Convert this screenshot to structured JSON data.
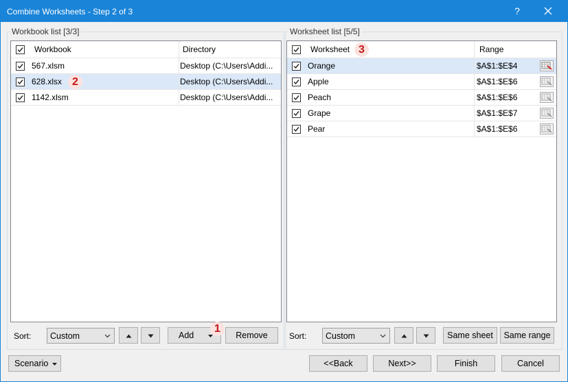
{
  "window": {
    "title": "Combine Worksheets - Step 2 of 3",
    "help_label": "?"
  },
  "workbook_panel": {
    "legend": "Workbook list [3/3]",
    "col_workbook": "Workbook",
    "col_directory": "Directory",
    "rows": [
      {
        "name": "567.xlsm",
        "directory": "Desktop (C:\\Users\\Addi...",
        "checked": true,
        "selected": false
      },
      {
        "name": "628.xlsx",
        "directory": "Desktop (C:\\Users\\Addi...",
        "checked": true,
        "selected": true
      },
      {
        "name": "1142.xlsm",
        "directory": "Desktop (C:\\Users\\Addi...",
        "checked": true,
        "selected": false
      }
    ],
    "sort_label": "Sort:",
    "sort_value": "Custom",
    "add_label": "Add",
    "remove_label": "Remove"
  },
  "worksheet_panel": {
    "legend": "Worksheet list [5/5]",
    "col_worksheet": "Worksheet",
    "col_range": "Range",
    "rows": [
      {
        "name": "Orange",
        "range": "$A$1:$E$4",
        "checked": true,
        "selected": true
      },
      {
        "name": "Apple",
        "range": "$A$1:$E$6",
        "checked": true,
        "selected": false
      },
      {
        "name": "Peach",
        "range": "$A$1:$E$6",
        "checked": true,
        "selected": false
      },
      {
        "name": "Grape",
        "range": "$A$1:$E$7",
        "checked": true,
        "selected": false
      },
      {
        "name": "Pear",
        "range": "$A$1:$E$6",
        "checked": true,
        "selected": false
      }
    ],
    "sort_label": "Sort:",
    "sort_value": "Custom",
    "same_sheet_label": "Same sheet",
    "same_range_label": "Same range"
  },
  "badges": {
    "one": "1",
    "two": "2",
    "three": "3"
  },
  "footer": {
    "scenario_label": "Scenario",
    "back_label": "<<Back",
    "next_label": "Next>>",
    "finish_label": "Finish",
    "cancel_label": "Cancel"
  },
  "colors": {
    "titlebar": "#1a84d8",
    "selected_row": "#dbe8f8",
    "badge_text": "#c0191a",
    "badge_bg": "#fde3df"
  }
}
